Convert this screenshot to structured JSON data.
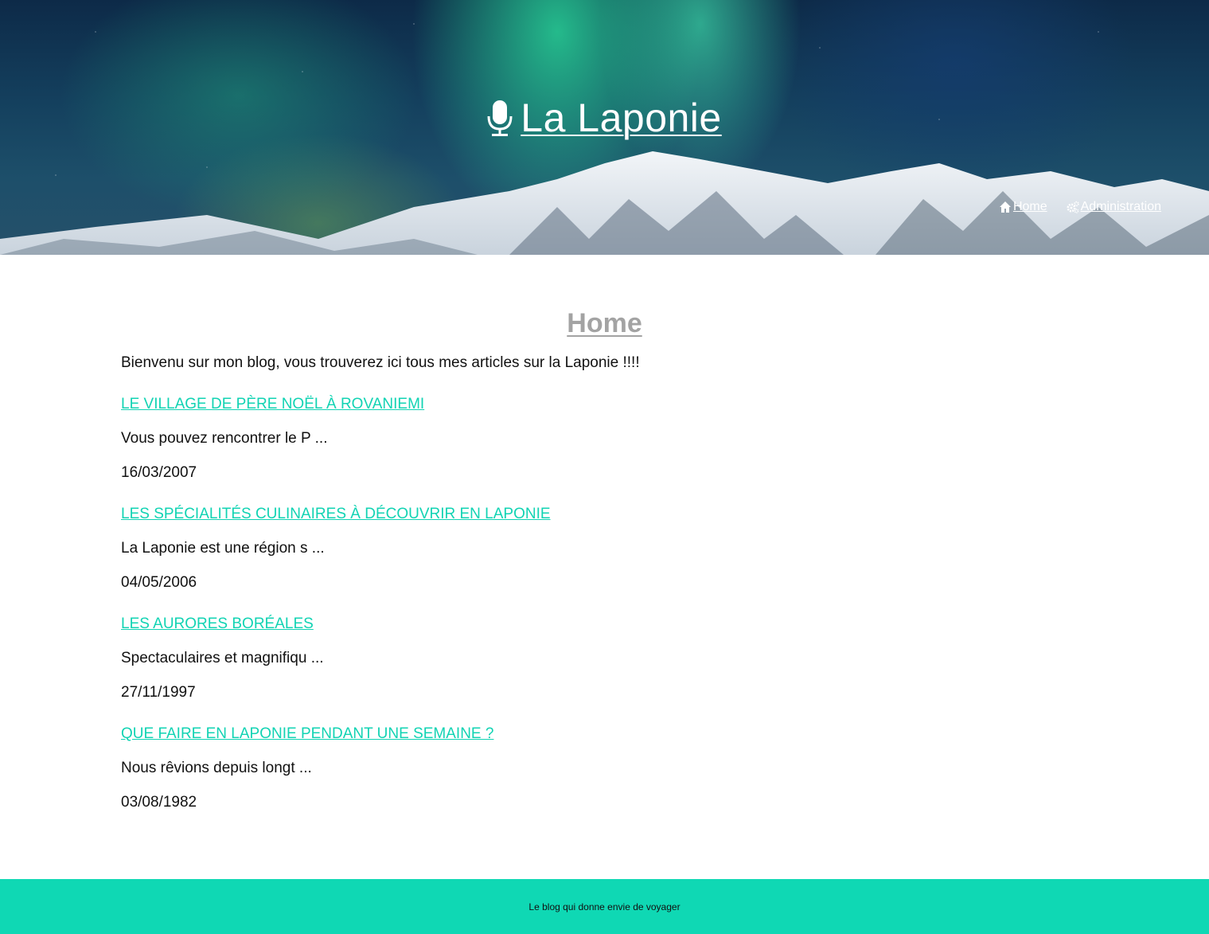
{
  "header": {
    "site_title": "La Laponie",
    "title_icon": "microphone-icon",
    "nav": [
      {
        "label": "Home",
        "icon": "home-icon"
      },
      {
        "label": "Administration",
        "icon": "cogs-icon"
      }
    ]
  },
  "main": {
    "heading": "Home",
    "intro": "Bienvenu sur mon blog, vous trouverez ici tous mes articles sur la Laponie !!!!",
    "articles": [
      {
        "title": "LE VILLAGE DE PÈRE NOËL À ROVANIEMI",
        "excerpt": "Vous pouvez rencontrer le P ...",
        "date": "16/03/2007"
      },
      {
        "title": "LES SPÉCIALITÉS CULINAIRES À DÉCOUVRIR EN LAPONIE",
        "excerpt": "La Laponie est une région s ...",
        "date": "04/05/2006"
      },
      {
        "title": "LES AURORES BORÉALES",
        "excerpt": "Spectaculaires et magnifiqu ...",
        "date": "27/11/1997"
      },
      {
        "title": "QUE FAIRE EN LAPONIE PENDANT UNE SEMAINE ?",
        "excerpt": "Nous rêvions depuis longt ...",
        "date": "03/08/1982"
      }
    ]
  },
  "footer": {
    "text": "Le blog qui donne envie de voyager"
  },
  "colors": {
    "accent": "#11d3b3",
    "footer_bg": "#0fd8b4",
    "heading_gray": "#a3a3a3"
  }
}
